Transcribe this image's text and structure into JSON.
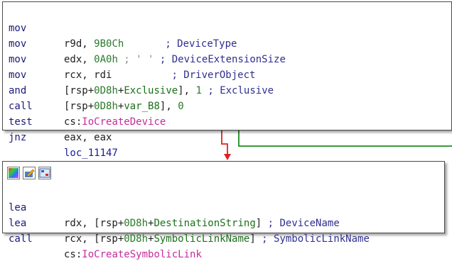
{
  "block1": {
    "lines": [
      {
        "mnemonic": "mov",
        "op1": "r9d, ",
        "op2": "9B0Ch",
        "comment": "; DeviceType"
      },
      {
        "mnemonic": "mov",
        "op1": "edx, ",
        "op2": "0A0h",
        "op3": " ; ' ' ",
        "comment": "; DeviceExtensionSize"
      },
      {
        "mnemonic": "mov",
        "op1": "rcx, rdi",
        "comment": "; DriverObject"
      },
      {
        "mnemonic": "mov",
        "op1": "[rsp+",
        "op2": "0D8h",
        "op3": "+",
        "op4": "Exclusive",
        "op5": "], ",
        "op6": "1",
        "comment": " ; Exclusive"
      },
      {
        "mnemonic": "and",
        "op1": "[rsp+",
        "op2": "0D8h",
        "op3": "+",
        "op4": "var_B8",
        "op5": "], ",
        "op6": "0"
      },
      {
        "mnemonic": "call",
        "op1": "cs:",
        "op2": "IoCreateDevice"
      },
      {
        "mnemonic": "test",
        "op1": "eax, eax"
      },
      {
        "mnemonic": "jnz",
        "op1": "loc_11147"
      }
    ]
  },
  "block2": {
    "toolbar": [
      "graph-color-icon",
      "edit-node-icon",
      "group-nodes-icon"
    ],
    "lines": [
      {
        "mnemonic": "lea",
        "op1": "rdx, [rsp+",
        "op2": "0D8h",
        "op3": "+",
        "op4": "DestinationString",
        "op5": "] ",
        "comment": "; DeviceName"
      },
      {
        "mnemonic": "lea",
        "op1": "rcx, [rsp+",
        "op2": "0D8h",
        "op3": "+",
        "op4": "SymbolicLinkName",
        "op5": "] ",
        "comment": "; SymbolicLinkName"
      },
      {
        "mnemonic": "call",
        "op1": "cs:",
        "op2": "IoCreateSymbolicLink"
      }
    ]
  },
  "colors": {
    "false_edge": "#e02020",
    "true_edge": "#1e8c1e",
    "import_name": "#c42b9b"
  }
}
